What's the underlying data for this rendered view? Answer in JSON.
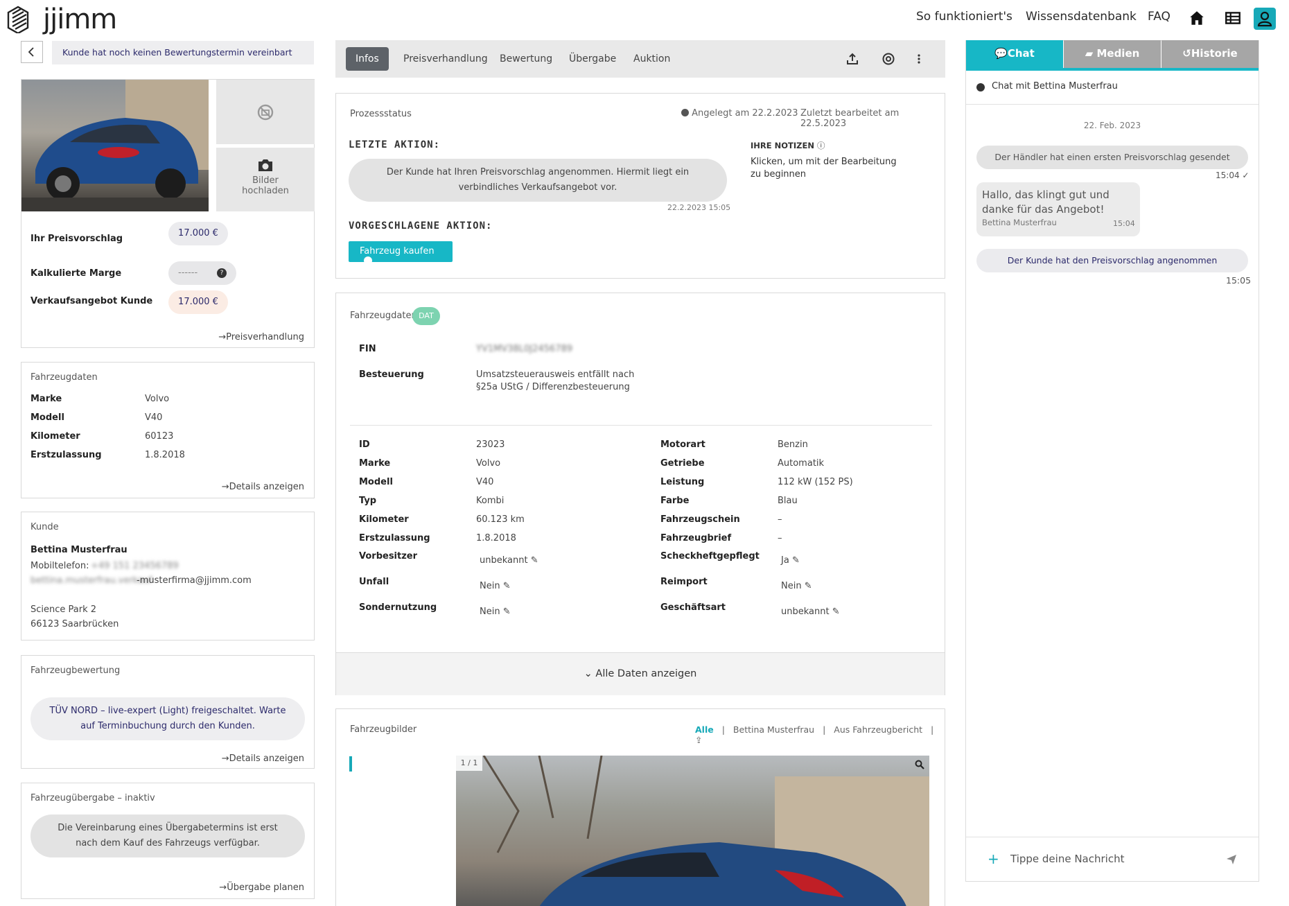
{
  "header": {
    "logo_text": "jjimm",
    "nav": [
      "So funktioniert's",
      "Wissensdatenbank",
      "FAQ"
    ],
    "icons": [
      "home-icon",
      "table-icon",
      "user-icon"
    ]
  },
  "left": {
    "status_text": "Kunde hat noch keinen Bewertungstermin vereinbart",
    "upload_label_1": "Bilder",
    "upload_label_2": "hochladen",
    "price": {
      "rows": [
        {
          "label": "Ihr Preisvorschlag",
          "value": "17.000 €"
        },
        {
          "label": "Kalkulierte Marge",
          "value": "------"
        },
        {
          "label": "Verkaufsangebot Kunde",
          "value": "17.000 €"
        }
      ],
      "link": "Preisverhandlung"
    },
    "vehicle": {
      "title": "Fahrzeugdaten",
      "rows": [
        {
          "label": "Marke",
          "value": "Volvo"
        },
        {
          "label": "Modell",
          "value": "V40"
        },
        {
          "label": "Kilometer",
          "value": "60123"
        },
        {
          "label": "Erstzulassung",
          "value": "1.8.2018"
        }
      ],
      "link": "Details anzeigen"
    },
    "customer": {
      "title": "Kunde",
      "name": "Bettina Musterfrau",
      "phone_label": "Mobiltelefon:",
      "phone_value": "+49 151 23456789",
      "email": "-musterfirma@jjimm.com",
      "email_prefix": "bettina.musterfrau.verkauf",
      "street": "Science Park 2",
      "city": "66123 Saarbrücken"
    },
    "rating": {
      "title": "Fahrzeugbewertung",
      "text": "TÜV NORD – live-expert (Light) freigeschaltet. Warte auf Terminbuchung durch den Kunden.",
      "link": "Details anzeigen"
    },
    "handover": {
      "title": "Fahrzeugübergabe – inaktiv",
      "text": "Die Vereinbarung eines Übergabetermins ist erst nach dem Kauf des Fahrzeugs verfügbar.",
      "link": "Übergabe planen"
    }
  },
  "middle": {
    "tabs": [
      "Infos",
      "Preisverhandlung",
      "Bewertung",
      "Übergabe",
      "Auktion"
    ],
    "process": {
      "title": "Prozessstatus",
      "created": "Angelegt am 22.2.2023",
      "edited": "Zuletzt bearbeitet am 22.5.2023",
      "last_action_heading": "LETZTE AKTION:",
      "last_action_text": "Der Kunde hat Ihren Preisvorschlag angenommen. Hiermit liegt ein verbindliches Verkaufsangebot vor.",
      "last_action_time": "22.2.2023 15:05",
      "suggested_heading": "VORGESCHLAGENE AKTION:",
      "suggested_button": "Fahrzeug kaufen",
      "notes_heading": "IHRE NOTIZEN",
      "notes_text": "Klicken, um mit der Bearbeitung zu beginnen"
    },
    "vehicle_data": {
      "title": "Fahrzeugdaten",
      "badge": "DAT",
      "fin_label": "FIN",
      "fin_value": "YV1MV38L0J2456789",
      "tax_label": "Besteuerung",
      "tax_value_1": "Umsatzsteuerausweis entfällt nach",
      "tax_value_2": "§25a UStG / Differenzbesteuerung",
      "left_rows": [
        {
          "label": "ID",
          "value": "23023"
        },
        {
          "label": "Marke",
          "value": "Volvo"
        },
        {
          "label": "Modell",
          "value": "V40"
        },
        {
          "label": "Typ",
          "value": "Kombi"
        },
        {
          "label": "Kilometer",
          "value": "60.123 km"
        },
        {
          "label": "Erstzulassung",
          "value": "1.8.2018"
        }
      ],
      "right_rows": [
        {
          "label": "Motorart",
          "value": "Benzin"
        },
        {
          "label": "Getriebe",
          "value": "Automatik"
        },
        {
          "label": "Leistung",
          "value": "112 kW (152 PS)"
        },
        {
          "label": "Farbe",
          "value": "Blau"
        },
        {
          "label": "Fahrzeugschein",
          "value": "–"
        },
        {
          "label": "Fahrzeugbrief",
          "value": "–"
        }
      ],
      "edit_left": [
        {
          "label": "Vorbesitzer",
          "value": "unbekannt"
        },
        {
          "label": "Unfall",
          "value": "Nein"
        },
        {
          "label": "Sondernutzung",
          "value": "Nein"
        }
      ],
      "edit_right": [
        {
          "label": "Scheckheftgepflegt",
          "value": "Ja"
        },
        {
          "label": "Reimport",
          "value": "Nein"
        },
        {
          "label": "Geschäftsart",
          "value": "unbekannt"
        }
      ],
      "show_all": "Alle Daten anzeigen"
    },
    "images": {
      "title": "Fahrzeugbilder",
      "filters": [
        "Alle",
        "Bettina Musterfrau",
        "Aus Fahrzeugbericht"
      ],
      "counter": "1 / 1"
    }
  },
  "right": {
    "tabs": [
      "Chat",
      "Medien",
      "Historie"
    ],
    "chat_with": "Chat mit Bettina Musterfrau",
    "date": "22. Feb. 2023",
    "messages": [
      {
        "text": "Der Händler hat einen ersten Preisvorschlag gesendet",
        "time": "15:04"
      },
      {
        "text": "Hallo, das klingt gut und danke für das Angebot!",
        "author": "Bettina Musterfrau",
        "time": "15:04"
      },
      {
        "text": "Der Kunde hat den Preisvorschlag angenommen",
        "time": "15:05"
      }
    ],
    "input_placeholder": "Tippe deine Nachricht"
  }
}
